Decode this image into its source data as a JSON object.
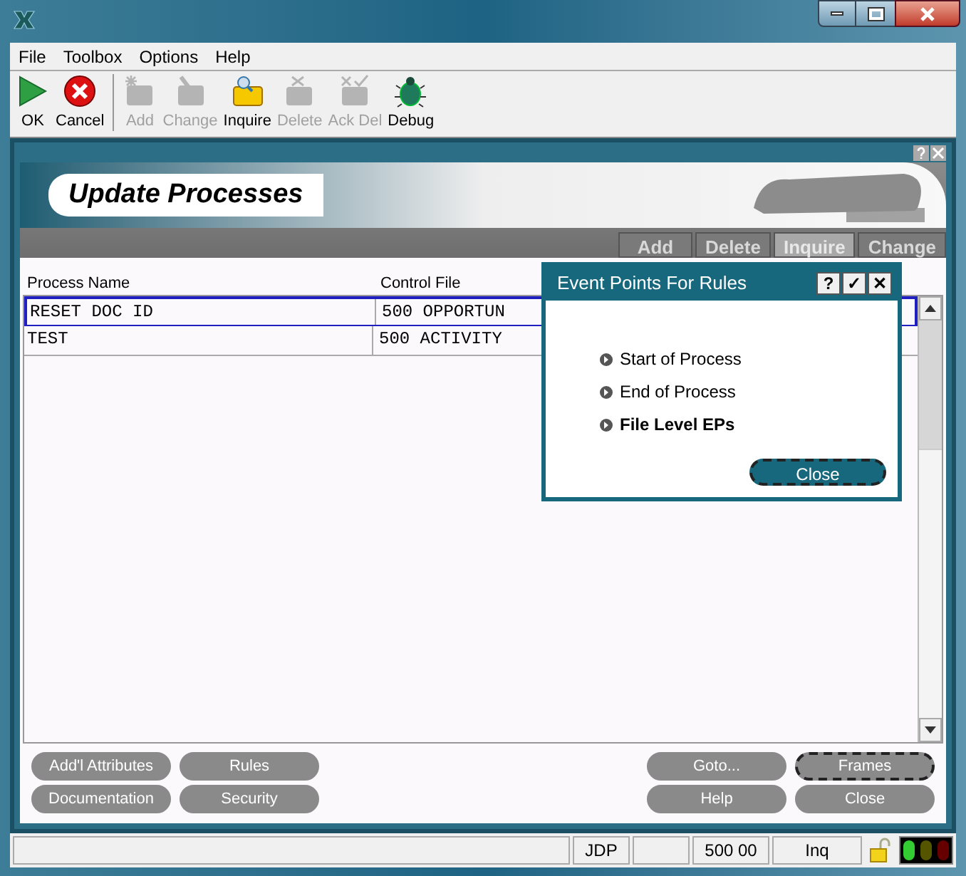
{
  "menu": [
    "File",
    "Toolbox",
    "Options",
    "Help"
  ],
  "toolbar": [
    {
      "label": "OK",
      "kind": "ok",
      "disabled": false
    },
    {
      "label": "Cancel",
      "kind": "cancel",
      "disabled": false
    },
    {
      "label": "Add",
      "kind": "add",
      "disabled": true
    },
    {
      "label": "Change",
      "kind": "change",
      "disabled": true
    },
    {
      "label": "Inquire",
      "kind": "inquire",
      "disabled": false
    },
    {
      "label": "Delete",
      "kind": "delete",
      "disabled": true
    },
    {
      "label": "Ack Del",
      "kind": "ackdel",
      "disabled": true
    },
    {
      "label": "Debug",
      "kind": "debug",
      "disabled": false
    }
  ],
  "panel": {
    "title": "Update Processes",
    "modes": [
      {
        "label": "Add",
        "selected": false
      },
      {
        "label": "Delete",
        "selected": false
      },
      {
        "label": "Inquire",
        "selected": true
      },
      {
        "label": "Change",
        "selected": false
      }
    ]
  },
  "table": {
    "columns": [
      "Process Name",
      "Control File"
    ],
    "rows": [
      {
        "cells": [
          "RESET DOC ID",
          "500 OPPORTUN"
        ],
        "selected": true
      },
      {
        "cells": [
          "TEST",
          "500 ACTIVITY"
        ],
        "selected": false
      }
    ]
  },
  "dialog": {
    "title": "Event Points For Rules",
    "title_buttons": [
      "?",
      "✓",
      "✕"
    ],
    "options": [
      {
        "label": "Start of Process",
        "selected": false
      },
      {
        "label": "End of Process",
        "selected": false
      },
      {
        "label": "File Level EPs",
        "selected": true
      }
    ],
    "close_button": {
      "label": "Close",
      "focused": true
    }
  },
  "buttons_left": [
    {
      "label": "Add'l Attributes",
      "focused": false
    },
    {
      "label": "Rules",
      "focused": false
    },
    {
      "label": "Documentation",
      "focused": false
    },
    {
      "label": "Security",
      "focused": false
    }
  ],
  "buttons_right": [
    {
      "label": "Goto...",
      "focused": false
    },
    {
      "label": "Frames",
      "focused": true
    },
    {
      "label": "Help",
      "focused": false
    },
    {
      "label": "Close",
      "focused": false
    }
  ],
  "status_bar": [
    {
      "kind": "blank"
    },
    {
      "kind": "text",
      "text": "JDP"
    },
    {
      "kind": "blank"
    },
    {
      "kind": "text",
      "text": "500 00"
    },
    {
      "kind": "text",
      "text": "Inq"
    }
  ]
}
